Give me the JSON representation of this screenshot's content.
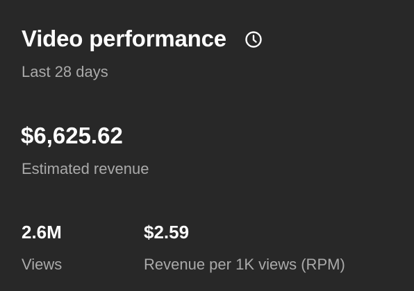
{
  "card": {
    "title": "Video performance",
    "title_icon": "clock-icon",
    "period": "Last 28 days",
    "revenue": {
      "value": "$6,625.62",
      "label": "Estimated revenue"
    },
    "metrics": [
      {
        "value": "2.6M",
        "label": "Views"
      },
      {
        "value": "$2.59",
        "label": "Revenue per 1K views (RPM)"
      }
    ]
  },
  "colors": {
    "background": "#282828",
    "primary_text": "#ffffff",
    "secondary_text": "#aaaaaa"
  }
}
